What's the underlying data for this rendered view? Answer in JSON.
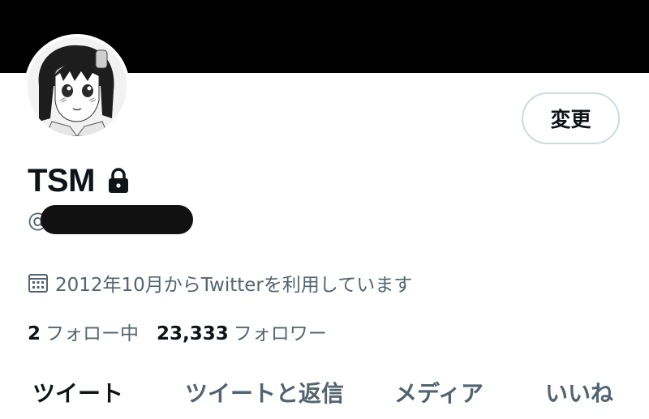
{
  "profile": {
    "display_name": "TSM",
    "handle_prefix": "@",
    "edit_button_label": "変更",
    "joined_text": "2012年10月からTwitterを利用しています",
    "following_count": "2",
    "following_label": "フォロー中",
    "followers_count": "23,333",
    "followers_label": "フォロワー"
  },
  "tabs": [
    {
      "label": "ツイート"
    },
    {
      "label": "ツイートと返信"
    },
    {
      "label": "メディア"
    },
    {
      "label": "いいね"
    }
  ],
  "icons": {
    "lock": "lock-icon",
    "calendar": "calendar-icon"
  },
  "colors": {
    "banner": "#000000",
    "primary_text": "#0f1419",
    "secondary_text": "#536471",
    "button_border": "#cfd9de"
  }
}
